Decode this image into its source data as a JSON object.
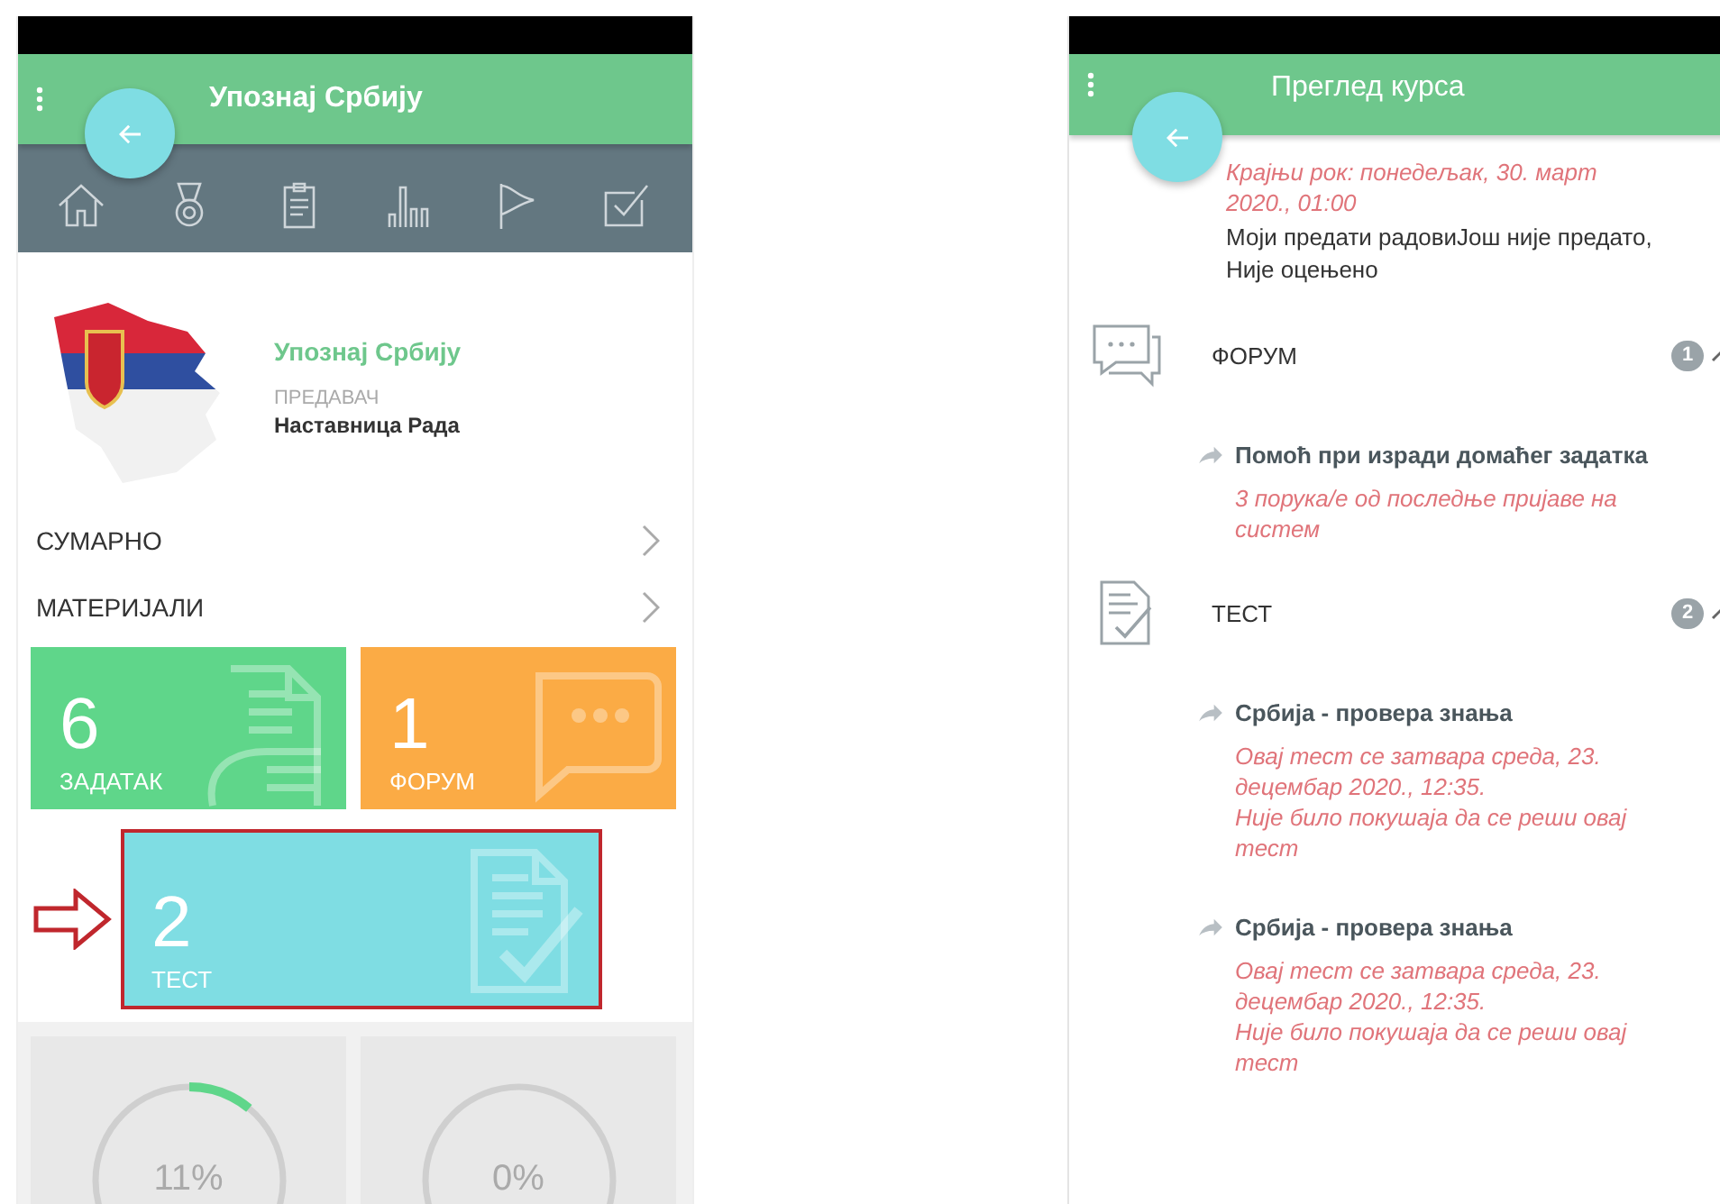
{
  "left_screen": {
    "title": "Упознај Србију",
    "course": {
      "title": "Упознај Србију",
      "teacher_label": "ПРЕДАВАЧ",
      "teacher": "Наставница Рада"
    },
    "links": [
      {
        "label": "СУМАРНО"
      },
      {
        "label": "МАТЕРИЈАЛИ"
      }
    ],
    "tiles": [
      {
        "kind": "assignment",
        "count": "6",
        "label": "ЗАДАТАК",
        "highlighted": false
      },
      {
        "kind": "forum",
        "count": "1",
        "label": "ФОРУМ",
        "highlighted": false
      },
      {
        "kind": "test",
        "count": "2",
        "label": "ТЕСТ",
        "highlighted": true
      }
    ],
    "progress": [
      {
        "reading": "11%",
        "level": 0.11
      },
      {
        "reading": "0%",
        "level": 0
      }
    ]
  },
  "right_screen": {
    "title": "Преглед курса",
    "deadline": "Крајњи рок: понедељак, 30. март 2020., 01:00",
    "submission": "Моји предати радовиЈош није предато, Није оцењено",
    "sections": [
      {
        "kind": "forum",
        "title": "ФОРУМ",
        "badge": "1",
        "items": [
          {
            "title": "Помоћ при изради домаћег задатка",
            "notes": [
              "3 порука/е од последње пријаве на систем"
            ]
          }
        ]
      },
      {
        "kind": "test",
        "title": "ТЕСТ",
        "badge": "2",
        "items": [
          {
            "title": "Србија - провера знања",
            "notes": [
              "Овај тест се затвара среда, 23. децембар 2020., 12:35.",
              "Није било покушаја да се реши овај тест"
            ]
          },
          {
            "title": "Србија - провера знања",
            "notes": [
              "Овај тест се затвара среда, 23. децембар 2020., 12:35.",
              "Није било покушаја да се реши овај тест"
            ]
          }
        ]
      }
    ]
  }
}
